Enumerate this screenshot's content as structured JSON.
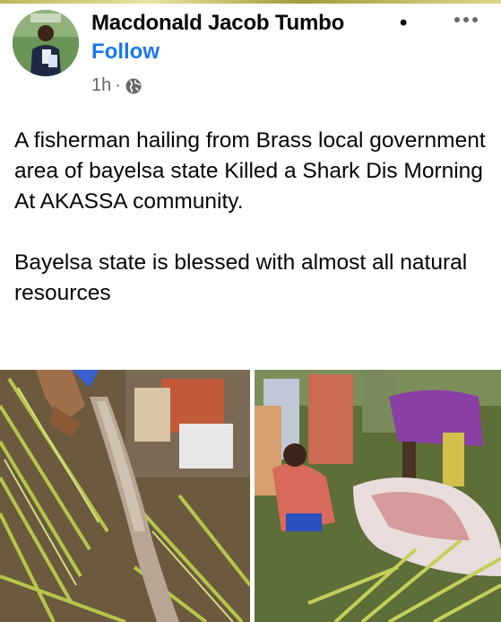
{
  "post": {
    "author_name": "Macdonald Jacob Tumbo",
    "separator_dot": "•",
    "follow_label": "Follow",
    "time": "1h",
    "meta_separator": "·",
    "privacy_icon": "globe-icon",
    "more_icon": "more-options-icon",
    "paragraphs": [
      "A fisherman hailing from Brass local government area of bayelsa state Killed a Shark Dis Morning At AKASSA community.",
      "Bayelsa state is blessed with almost all natural resources"
    ]
  },
  "colors": {
    "link_blue": "#1877f2",
    "secondary_text": "#65676b",
    "primary_text": "#050505"
  }
}
